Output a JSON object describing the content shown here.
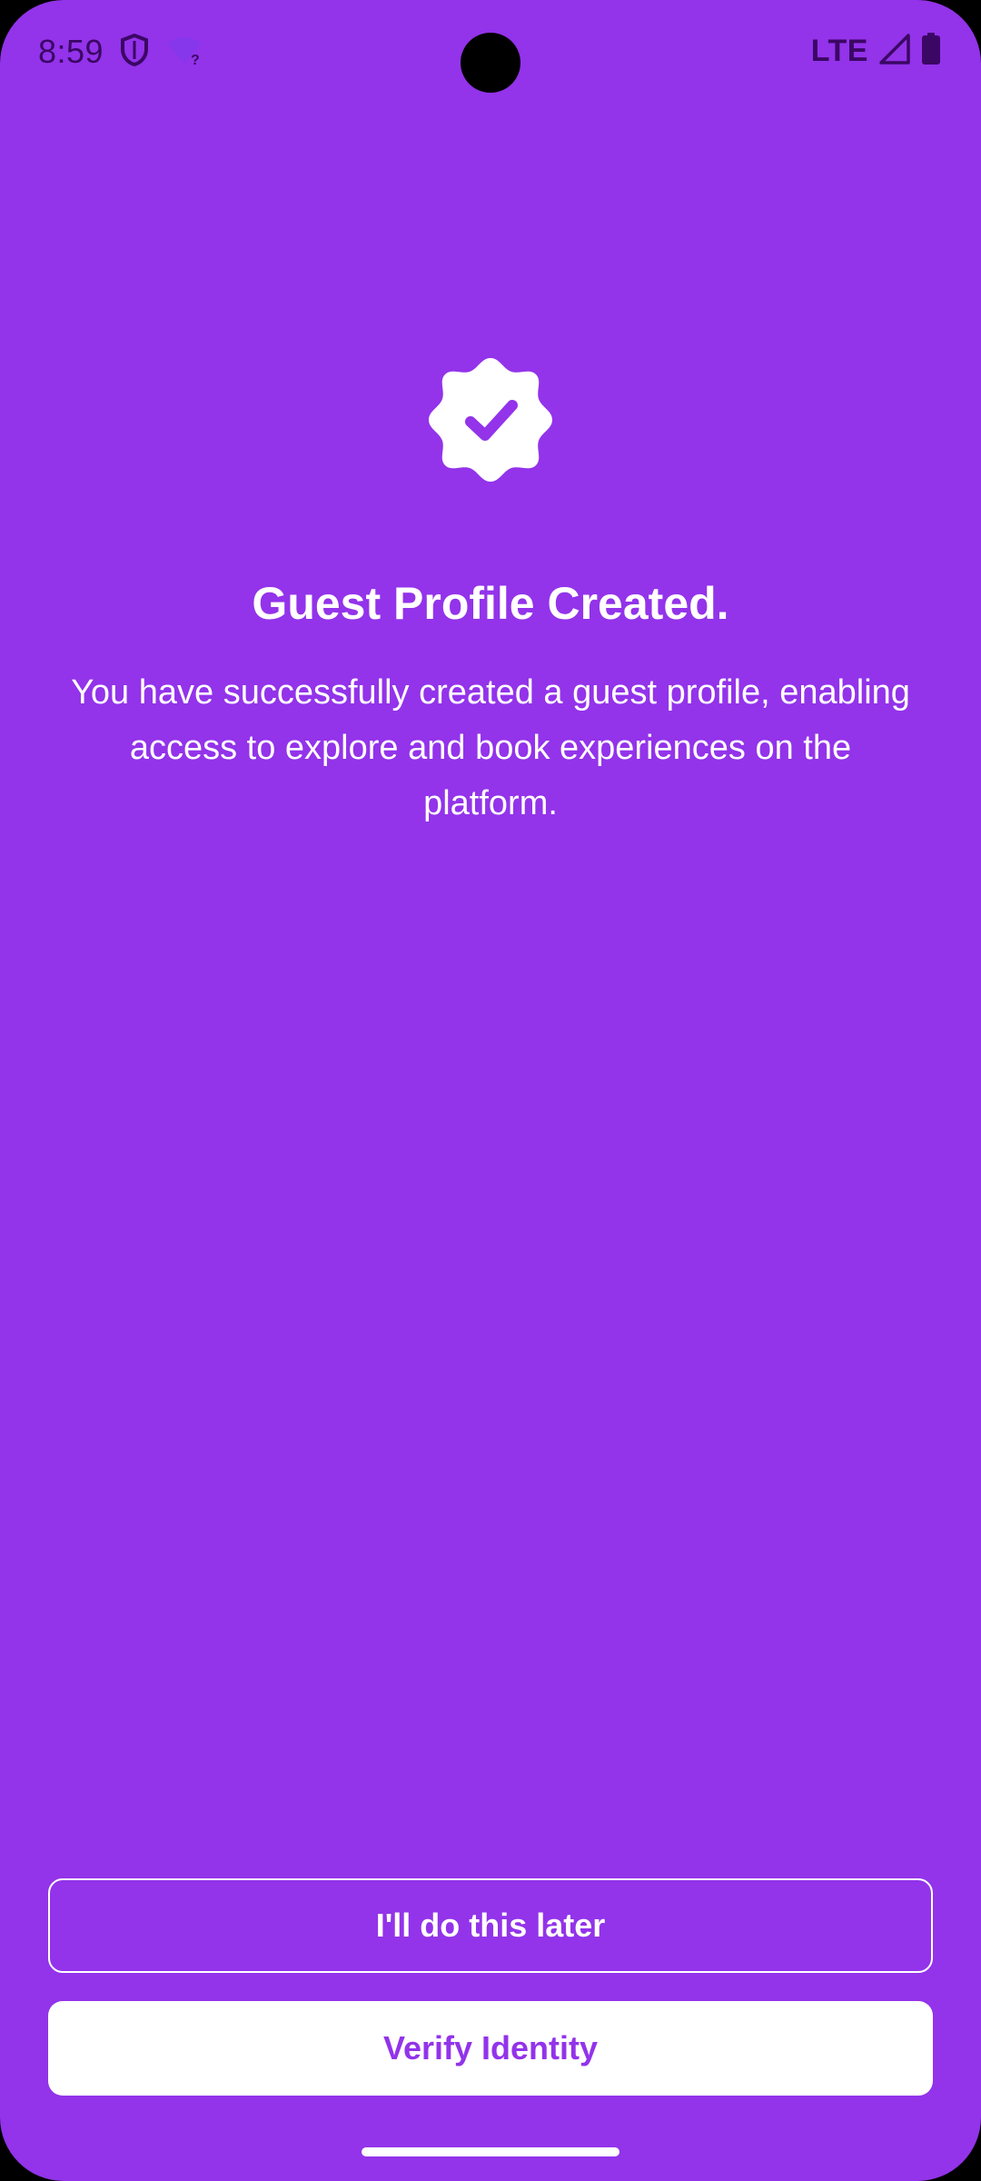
{
  "status_bar": {
    "time": "8:59",
    "network": "LTE",
    "icons": [
      "shield-icon",
      "wifi-question-icon",
      "signal-icon",
      "battery-icon"
    ]
  },
  "colors": {
    "background": "#9333EA",
    "text": "#FFFFFF",
    "primary_button_text": "#9333EA"
  },
  "success": {
    "icon": "verified-badge-icon",
    "title": "Guest Profile Created.",
    "message": "You have successfully created a guest profile, enabling access to explore and book experiences on the platform."
  },
  "actions": {
    "later_label": "I'll do this later",
    "verify_label": "Verify Identity"
  }
}
